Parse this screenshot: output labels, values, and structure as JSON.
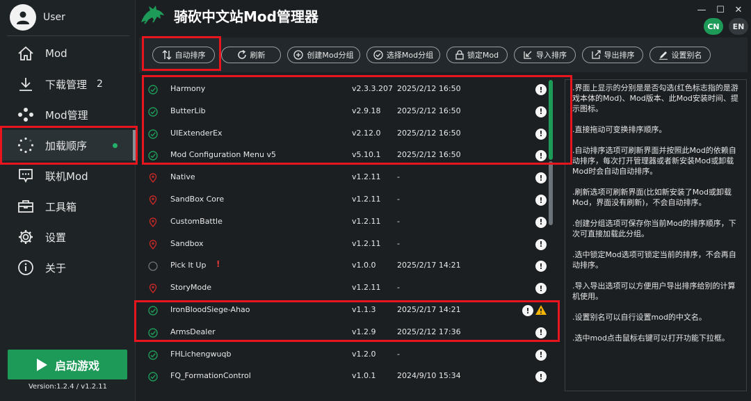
{
  "app": {
    "title": "骑砍中文站Mod管理器",
    "version": "Version:1.2.4 / v1.2.11",
    "start_label": "启动游戏"
  },
  "user": {
    "name": "User"
  },
  "nav": [
    {
      "label": "Mod",
      "icon": "home-icon"
    },
    {
      "label": "下载管理",
      "icon": "download-icon",
      "badge": "2"
    },
    {
      "label": "Mod管理",
      "icon": "mods-icon"
    },
    {
      "label": "加载顺序",
      "icon": "loading-spinner-icon",
      "active": true
    },
    {
      "label": "联机Mod",
      "icon": "chat-icon"
    },
    {
      "label": "工具箱",
      "icon": "toolbox-icon"
    },
    {
      "label": "设置",
      "icon": "gear-icon"
    },
    {
      "label": "关于",
      "icon": "info-icon"
    }
  ],
  "lang": {
    "cn": "CN",
    "en": "EN"
  },
  "window": {
    "minimize": "—",
    "maximize": "☐",
    "close": "✕"
  },
  "toolbar": [
    {
      "label": "自动排序",
      "icon": "sort-icon"
    },
    {
      "label": "刷新",
      "icon": "refresh-icon"
    },
    {
      "label": "创建Mod分组",
      "icon": "plus-circle-icon"
    },
    {
      "label": "选择Mod分组",
      "icon": "check-circle-icon"
    },
    {
      "label": "锁定Mod",
      "icon": "lock-icon"
    },
    {
      "label": "导入排序",
      "icon": "import-icon"
    },
    {
      "label": "导出排序",
      "icon": "export-icon"
    },
    {
      "label": "设置别名",
      "icon": "edit-icon"
    }
  ],
  "mods": [
    {
      "name": "Harmony",
      "version": "v2.3.3.207",
      "date": "2025/2/12 16:50",
      "status": "checked"
    },
    {
      "name": "ButterLib",
      "version": "v2.9.18",
      "date": "2025/2/12 16:50",
      "status": "checked"
    },
    {
      "name": "UIExtenderEx",
      "version": "v2.12.0",
      "date": "2025/2/12 16:50",
      "status": "checked"
    },
    {
      "name": "Mod Configuration Menu v5",
      "version": "v5.10.1",
      "date": "2025/2/12 16:50",
      "status": "checked"
    },
    {
      "name": "Native",
      "version": "v1.2.11",
      "date": "-",
      "status": "official"
    },
    {
      "name": "SandBox Core",
      "version": "v1.2.11",
      "date": "-",
      "status": "official"
    },
    {
      "name": "CustomBattle",
      "version": "v1.2.11",
      "date": "-",
      "status": "official"
    },
    {
      "name": "Sandbox",
      "version": "v1.2.11",
      "date": "-",
      "status": "official"
    },
    {
      "name": "Pick It Up",
      "version": "v1.0.0",
      "date": "2025/2/17 14:21",
      "status": "unchecked",
      "mark": "!"
    },
    {
      "name": "StoryMode",
      "version": "v1.2.11",
      "date": "-",
      "status": "official"
    },
    {
      "name": "IronBloodSiege-Ahao",
      "version": "v1.1.3",
      "date": "2025/2/17 14:21",
      "status": "checked",
      "warning": true
    },
    {
      "name": "ArmsDealer",
      "version": "v1.2.9",
      "date": "2025/2/12 17:36",
      "status": "checked"
    },
    {
      "name": "FHLichengwuqb",
      "version": "v1.2.0",
      "date": "-",
      "status": "checked"
    },
    {
      "name": "FQ_FormationControl",
      "version": "v1.0.1",
      "date": "2024/9/10 15:34",
      "status": "checked"
    }
  ],
  "info_symbol": "!",
  "help": [
    ".界面上显示的分别是是否勾选(红色标志指的是游戏本体的Mod)、Mod版本、此Mod安装时间、提示图标。",
    ".直接拖动可变换排序顺序。",
    ".自动排序选项可刷新界面并按照此Mod的依赖自动排序，每次打开管理器或者新安装Mod或卸载Mod时会自动自动排序。",
    ".刷新选项可刷新界面(比如新安装了Mod或卸载Mod，界面没有刷新)，不会自动排序。",
    ".创建分组选项可保存你当前Mod的排序顺序，下次可直接加载此分组。",
    ".选中锁定Mod选项可锁定当前的排序，不会再自动排序。",
    ".导入导出选项可以方便用户导出排序给别的计算机使用。",
    ".设置别名可以自行设置mod的中文名。",
    ".选中mod点击鼠标右键可以打开功能下拉框。"
  ],
  "colors": {
    "accent": "#1e9a58",
    "highlight": "#e8141e",
    "official_marker": "#c62828",
    "background": "#1b1f22"
  }
}
